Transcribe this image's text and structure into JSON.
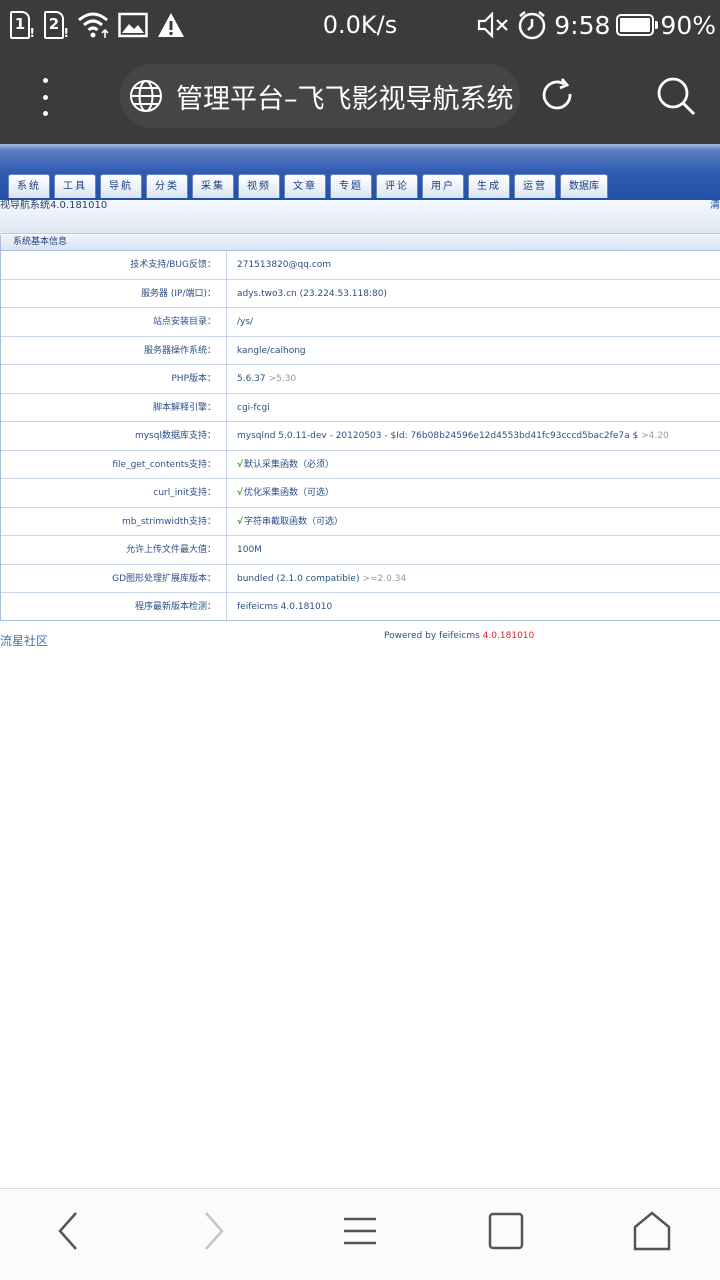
{
  "status_bar": {
    "sim1": "1",
    "sim2": "2",
    "net_speed": "0.0K/s",
    "time": "9:58",
    "battery": "90%",
    "battery_level": 0.9
  },
  "browser": {
    "title": "管理平台–飞飞影视导航系统"
  },
  "admin": {
    "nav_tabs": [
      "系统",
      "工具",
      "导航",
      "分类",
      "采集",
      "视频",
      "文章",
      "专题",
      "评论",
      "用户",
      "生成",
      "运营",
      "数据库"
    ],
    "version_text": "视导航系统4.0.181010",
    "clear_link": "清",
    "panel_title": "系统基本信息",
    "rows": [
      {
        "label": "技术支持/BUG反馈：",
        "value": "271513820@qq.com",
        "hint": "",
        "check": ""
      },
      {
        "label": "服务器 (IP/端口)：",
        "value": "adys.two3.cn (23.224.53.118:80)",
        "hint": "",
        "check": ""
      },
      {
        "label": "站点安装目录：",
        "value": "/ys/",
        "hint": "",
        "check": ""
      },
      {
        "label": "服务器操作系统：",
        "value": "kangle/caihong",
        "hint": "",
        "check": ""
      },
      {
        "label": "PHP版本：",
        "value": "5.6.37",
        "hint": ">5.30",
        "check": ""
      },
      {
        "label": "脚本解释引擎：",
        "value": "cgi-fcgi",
        "hint": "",
        "check": ""
      },
      {
        "label": "mysql数据库支持：",
        "value": "mysqlnd 5.0.11-dev - 20120503 - $Id: 76b08b24596e12d4553bd41fc93cccd5bac2fe7a $",
        "hint": ">4.20",
        "check": ""
      },
      {
        "label": "file_get_contents支持：",
        "value": "默认采集函数（必须）",
        "hint": "",
        "check": "√"
      },
      {
        "label": "curl_init支持：",
        "value": "优化采集函数（可选）",
        "hint": "",
        "check": "√"
      },
      {
        "label": "mb_strimwidth支持：",
        "value": "字符串截取函数（可选）",
        "hint": "",
        "check": "√"
      },
      {
        "label": "允许上传文件最大值：",
        "value": "100M",
        "hint": "",
        "check": ""
      },
      {
        "label": "GD图形处理扩展库版本：",
        "value": "bundled (2.1.0 compatible)",
        "hint": ">=2.0.34",
        "check": ""
      },
      {
        "label": "程序最新版本检测：",
        "value": "feifeicms 4.0.181010",
        "hint": "",
        "check": ""
      }
    ],
    "footer_link": "流星社区",
    "powered_text": "Powered by feifeicms",
    "powered_version": "4.0.181010"
  }
}
